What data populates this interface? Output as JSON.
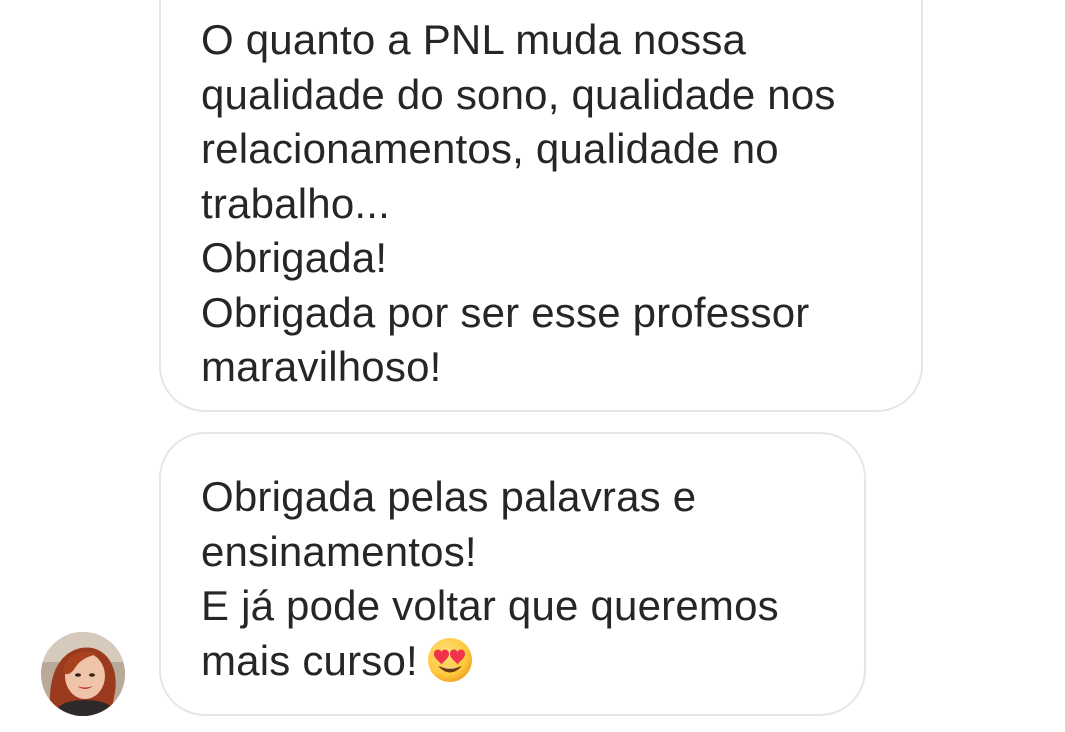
{
  "conversation": {
    "messages": [
      {
        "lines": [
          "O quanto a PNL muda nossa",
          "qualidade do sono, qualidade nos",
          "relacionamentos, qualidade no",
          "trabalho...",
          "Obrigada!",
          "Obrigada por ser esse professor",
          "maravilhoso!"
        ]
      },
      {
        "lines": [
          "Obrigada pelas palavras e",
          "ensinamentos!",
          "E já pode voltar que queremos",
          "mais curso!"
        ],
        "trailing_emoji": "smiling-face-with-heart-eyes"
      }
    ]
  },
  "colors": {
    "bubble_border": "#e6e6e6",
    "text": "#262626",
    "emoji_face": "#ffc83d",
    "emoji_heart": "#f0324a"
  }
}
